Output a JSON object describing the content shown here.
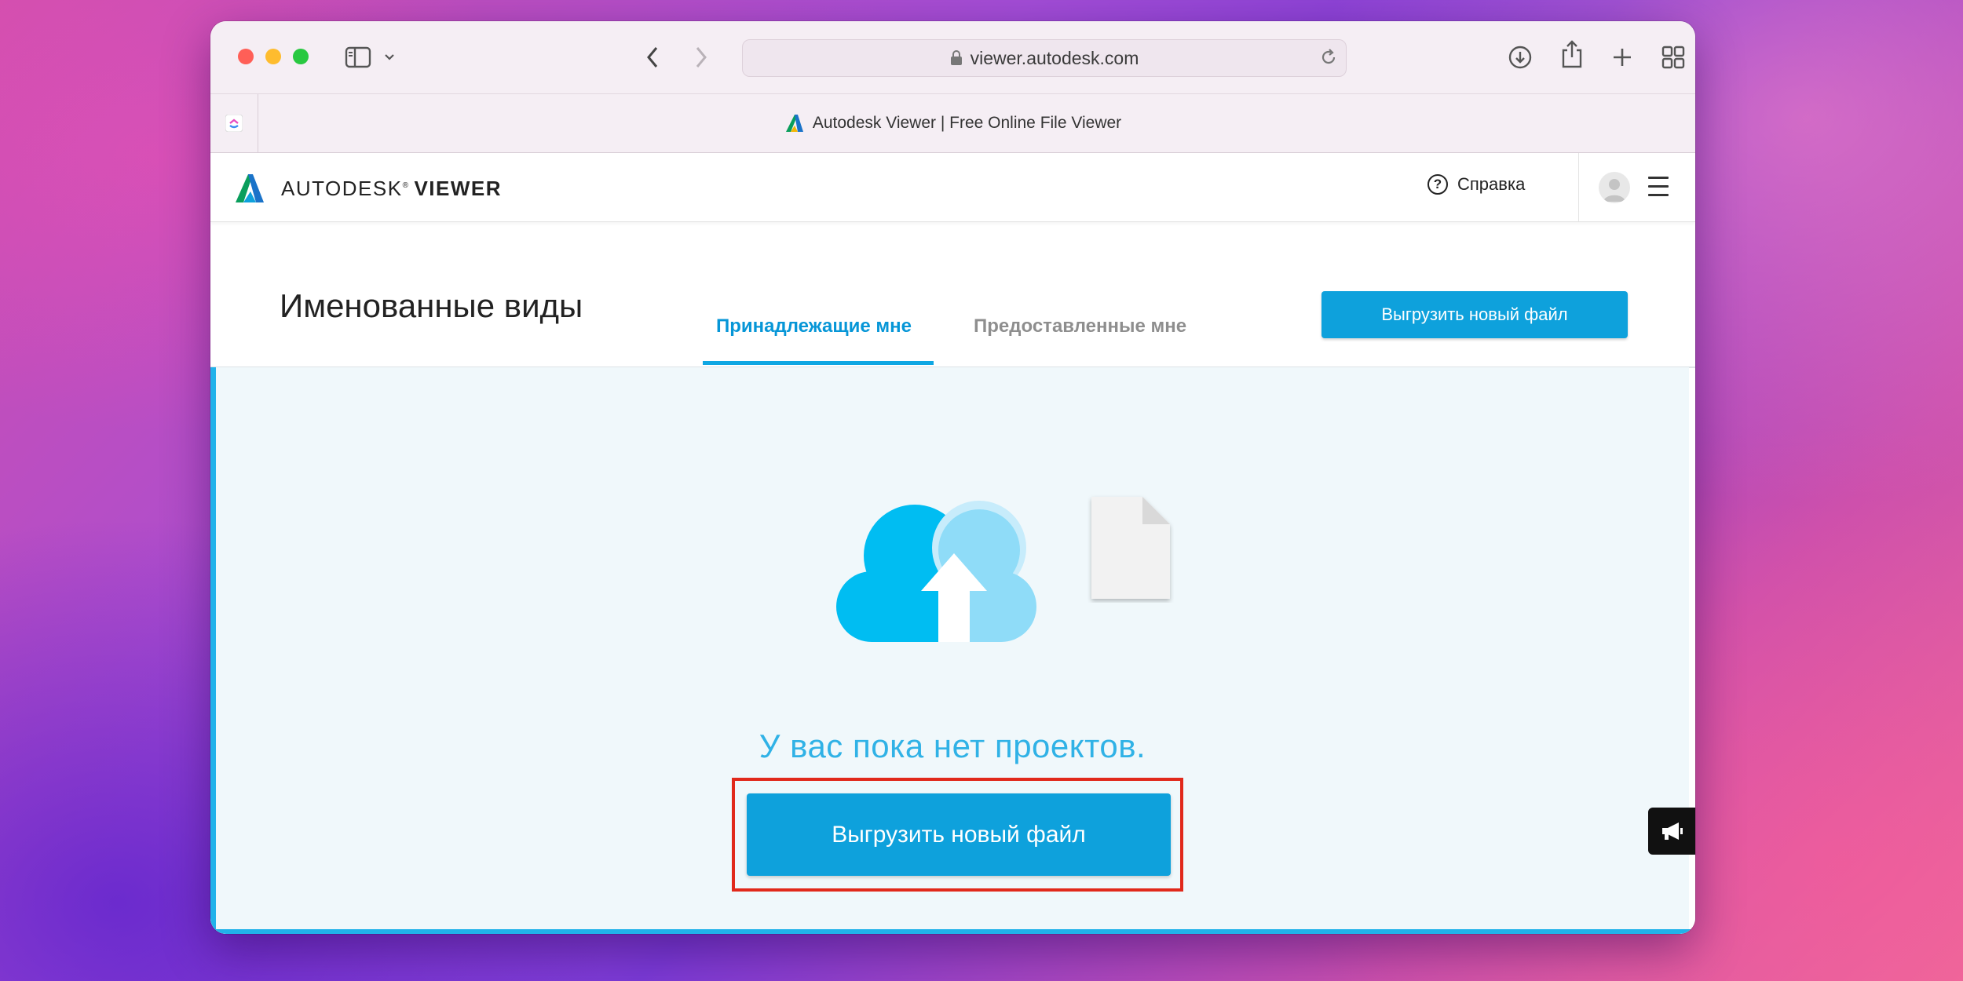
{
  "browser": {
    "url": "viewer.autodesk.com",
    "tab_title": "Autodesk Viewer | Free Online File Viewer"
  },
  "app": {
    "brand_primary": "AUTODESK",
    "brand_mark": "®",
    "brand_secondary": "VIEWER",
    "help_label": "Справка"
  },
  "page": {
    "title": "Именованные виды",
    "tabs": [
      {
        "label": "Принадлежащие мне",
        "active": true
      },
      {
        "label": "Предоставленные мне",
        "active": false
      }
    ],
    "upload_button_top": "Выгрузить новый файл",
    "empty_message": "У вас пока нет проектов.",
    "upload_button_main": "Выгрузить новый файл"
  },
  "colors": {
    "accent": "#0ea1dc",
    "highlight_outline": "#e1291b",
    "panel_bg": "#f0f8fb"
  },
  "icons": [
    "sidebar-icon",
    "chevron-down-icon",
    "back-icon",
    "forward-icon",
    "funnel-icon",
    "shield-check-icon",
    "fast-forward-icon",
    "moon-icon",
    "lock-icon",
    "reload-icon",
    "download-icon",
    "share-icon",
    "plus-icon",
    "tab-grid-icon",
    "autodesk-logo-icon",
    "help-icon",
    "avatar",
    "hamburger-menu-icon",
    "cloud-upload-icon",
    "file-icon",
    "megaphone-icon"
  ]
}
